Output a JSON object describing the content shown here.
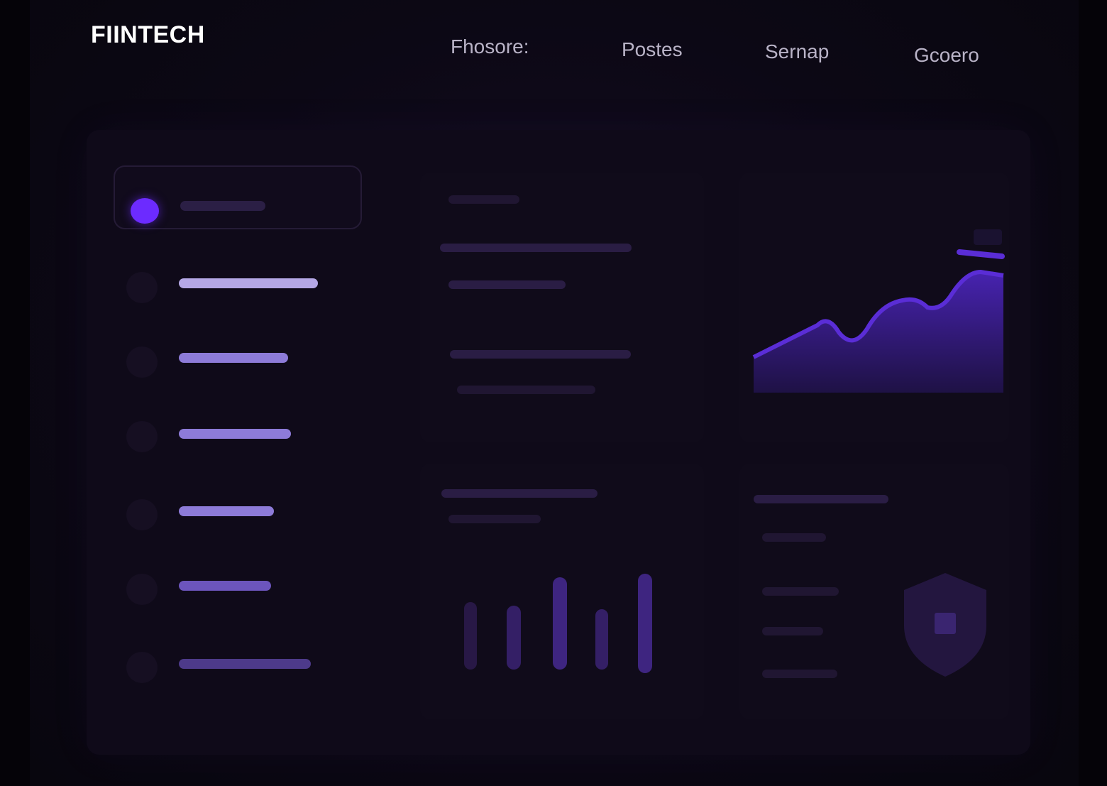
{
  "header": {
    "brand": "FIINTECH",
    "nav": [
      {
        "label": "Fhosore:"
      },
      {
        "label": "Postes"
      },
      {
        "label": "Sernap"
      },
      {
        "label": "Gcoero"
      }
    ]
  },
  "sidebar": {
    "active_index": 0,
    "item_count": 7
  },
  "charts": {
    "area_chart": {
      "color": "#5a2dd6",
      "fill": "#3a2093"
    },
    "bar_chart": {
      "color": "#4a2a9e",
      "bar_count": 5
    }
  },
  "security_panel": {
    "icon": "shield-icon",
    "color": "#3a2570"
  },
  "colors": {
    "accent": "#6c2bff",
    "background": "#0c0815",
    "sidebar_label": "#8d7bd8"
  }
}
